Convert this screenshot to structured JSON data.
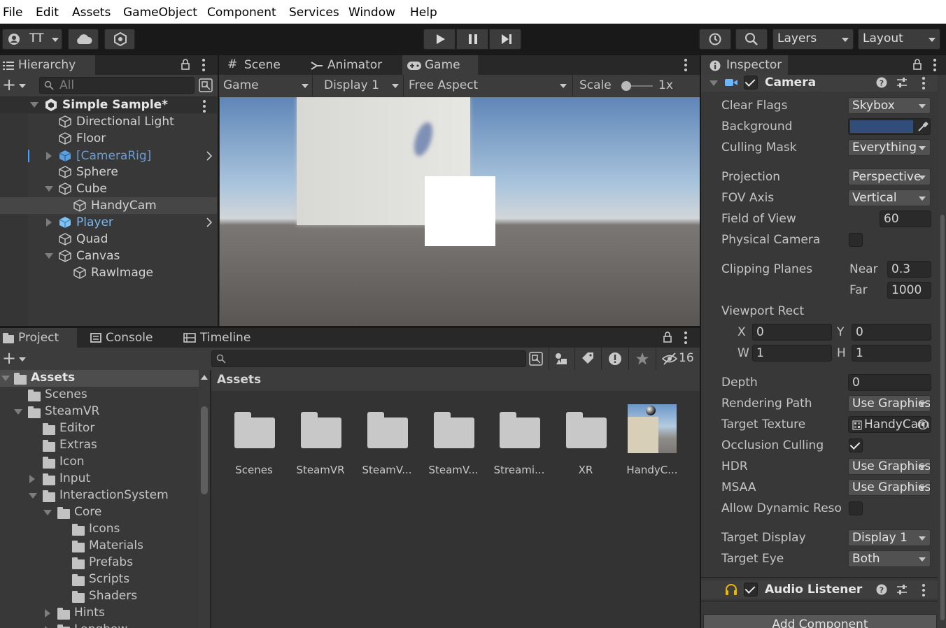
{
  "menu": [
    "File",
    "Edit",
    "Assets",
    "GameObject",
    "Component",
    "Services",
    "Window",
    "Help"
  ],
  "toolbar": {
    "account_label": "TT",
    "layers_label": "Layers",
    "layout_label": "Layout"
  },
  "hierarchy": {
    "tab_label": "Hierarchy",
    "search_placeholder": "All",
    "scene_name": "Simple Sample*",
    "items": [
      {
        "label": "Directional Light"
      },
      {
        "label": "Floor"
      },
      {
        "label": "[CameraRig]"
      },
      {
        "label": "Sphere"
      },
      {
        "label": "Cube"
      },
      {
        "label": "HandyCam"
      },
      {
        "label": "Player"
      },
      {
        "label": "Quad"
      },
      {
        "label": "Canvas"
      },
      {
        "label": "RawImage"
      }
    ]
  },
  "view_tabs": {
    "scene": "Scene",
    "animator": "Animator",
    "game": "Game"
  },
  "game_toolbar": {
    "mode": "Game",
    "display": "Display 1",
    "aspect": "Free Aspect",
    "scale_label": "Scale",
    "scale_value": "1x"
  },
  "project": {
    "tabs": [
      "Project",
      "Console",
      "Timeline"
    ],
    "hidden_count": "16",
    "breadcrumb": "Assets",
    "tree": [
      {
        "label": "Assets"
      },
      {
        "label": "Scenes"
      },
      {
        "label": "SteamVR"
      },
      {
        "label": "Editor"
      },
      {
        "label": "Extras"
      },
      {
        "label": "Icon"
      },
      {
        "label": "Input"
      },
      {
        "label": "InteractionSystem"
      },
      {
        "label": "Core"
      },
      {
        "label": "Icons"
      },
      {
        "label": "Materials"
      },
      {
        "label": "Prefabs"
      },
      {
        "label": "Scripts"
      },
      {
        "label": "Shaders"
      },
      {
        "label": "Hints"
      },
      {
        "label": "Longbow"
      }
    ],
    "assets": [
      {
        "label": "Scenes"
      },
      {
        "label": "SteamVR"
      },
      {
        "label": "SteamV..."
      },
      {
        "label": "SteamV..."
      },
      {
        "label": "Streami..."
      },
      {
        "label": "XR"
      },
      {
        "label": "HandyC..."
      }
    ]
  },
  "inspector": {
    "tab_label": "Inspector",
    "component_name": "Camera",
    "fields": {
      "clear_flags": {
        "label": "Clear Flags",
        "value": "Skybox"
      },
      "background": {
        "label": "Background",
        "color": "#314d79"
      },
      "culling_mask": {
        "label": "Culling Mask",
        "value": "Everything"
      },
      "projection": {
        "label": "Projection",
        "value": "Perspective"
      },
      "fov_axis": {
        "label": "FOV Axis",
        "value": "Vertical"
      },
      "field_of_view": {
        "label": "Field of View",
        "value": "60"
      },
      "physical_camera": {
        "label": "Physical Camera"
      },
      "clipping_planes": {
        "label": "Clipping Planes",
        "near_label": "Near",
        "near": "0.3",
        "far_label": "Far",
        "far": "1000"
      },
      "viewport_rect": {
        "label": "Viewport Rect",
        "x_label": "X",
        "x": "0",
        "y_label": "Y",
        "y": "0",
        "w_label": "W",
        "w": "1",
        "h_label": "H",
        "h": "1"
      },
      "depth": {
        "label": "Depth",
        "value": "0"
      },
      "rendering_path": {
        "label": "Rendering Path",
        "value": "Use Graphics Settings"
      },
      "target_texture": {
        "label": "Target Texture",
        "value": "HandyCam"
      },
      "occlusion_culling": {
        "label": "Occlusion Culling"
      },
      "hdr": {
        "label": "HDR",
        "value": "Use Graphics Settings"
      },
      "msaa": {
        "label": "MSAA",
        "value": "Use Graphics Settings"
      },
      "allow_dynamic_resolution": {
        "label": "Allow Dynamic Reso"
      },
      "target_display": {
        "label": "Target Display",
        "value": "Display 1"
      },
      "target_eye": {
        "label": "Target Eye",
        "value": "Both"
      }
    },
    "audio_listener": "Audio Listener",
    "add_component": "Add Component"
  }
}
